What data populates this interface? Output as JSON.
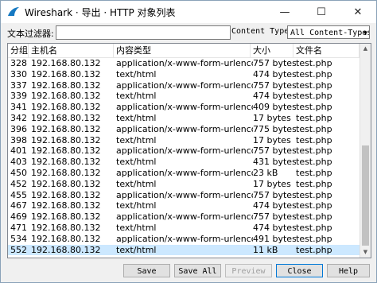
{
  "window": {
    "title": "Wireshark · 导出 · HTTP 对象列表",
    "controls": {
      "minimize": "—",
      "maximize": "☐",
      "close": "✕"
    }
  },
  "filter": {
    "label": "文本过滤器:",
    "value": "",
    "content_type_label": "Content Type:",
    "content_type_selected": "All Content-Types"
  },
  "table": {
    "columns": [
      "分组",
      "主机名",
      "内容类型",
      "大小",
      "文件名"
    ],
    "rows": [
      [
        "328",
        "192.168.80.132",
        "application/x-www-form-urlencoded",
        "757 bytes",
        "test.php"
      ],
      [
        "330",
        "192.168.80.132",
        "text/html",
        "474 bytes",
        "test.php"
      ],
      [
        "337",
        "192.168.80.132",
        "application/x-www-form-urlencoded",
        "757 bytes",
        "test.php"
      ],
      [
        "339",
        "192.168.80.132",
        "text/html",
        "474 bytes",
        "test.php"
      ],
      [
        "341",
        "192.168.80.132",
        "application/x-www-form-urlencoded",
        "409 bytes",
        "test.php"
      ],
      [
        "342",
        "192.168.80.132",
        "text/html",
        "17 bytes",
        "test.php"
      ],
      [
        "396",
        "192.168.80.132",
        "application/x-www-form-urlencoded",
        "775 bytes",
        "test.php"
      ],
      [
        "398",
        "192.168.80.132",
        "text/html",
        "17 bytes",
        "test.php"
      ],
      [
        "401",
        "192.168.80.132",
        "application/x-www-form-urlencoded",
        "757 bytes",
        "test.php"
      ],
      [
        "403",
        "192.168.80.132",
        "text/html",
        "431 bytes",
        "test.php"
      ],
      [
        "450",
        "192.168.80.132",
        "application/x-www-form-urlencoded",
        "23 kB",
        "test.php"
      ],
      [
        "452",
        "192.168.80.132",
        "text/html",
        "17 bytes",
        "test.php"
      ],
      [
        "455",
        "192.168.80.132",
        "application/x-www-form-urlencoded",
        "757 bytes",
        "test.php"
      ],
      [
        "467",
        "192.168.80.132",
        "text/html",
        "474 bytes",
        "test.php"
      ],
      [
        "469",
        "192.168.80.132",
        "application/x-www-form-urlencoded",
        "757 bytes",
        "test.php"
      ],
      [
        "471",
        "192.168.80.132",
        "text/html",
        "474 bytes",
        "test.php"
      ],
      [
        "534",
        "192.168.80.132",
        "application/x-www-form-urlencoded",
        "491 bytes",
        "test.php"
      ],
      [
        "552",
        "192.168.80.132",
        "text/html",
        "11 kB",
        "test.php"
      ]
    ],
    "selected_row": 17
  },
  "buttons": {
    "save": "Save",
    "save_all": "Save All",
    "preview": "Preview",
    "close": "Close",
    "help": "Help"
  },
  "colors": {
    "selection": "#cce8ff",
    "focus_border": "#0078d7"
  }
}
